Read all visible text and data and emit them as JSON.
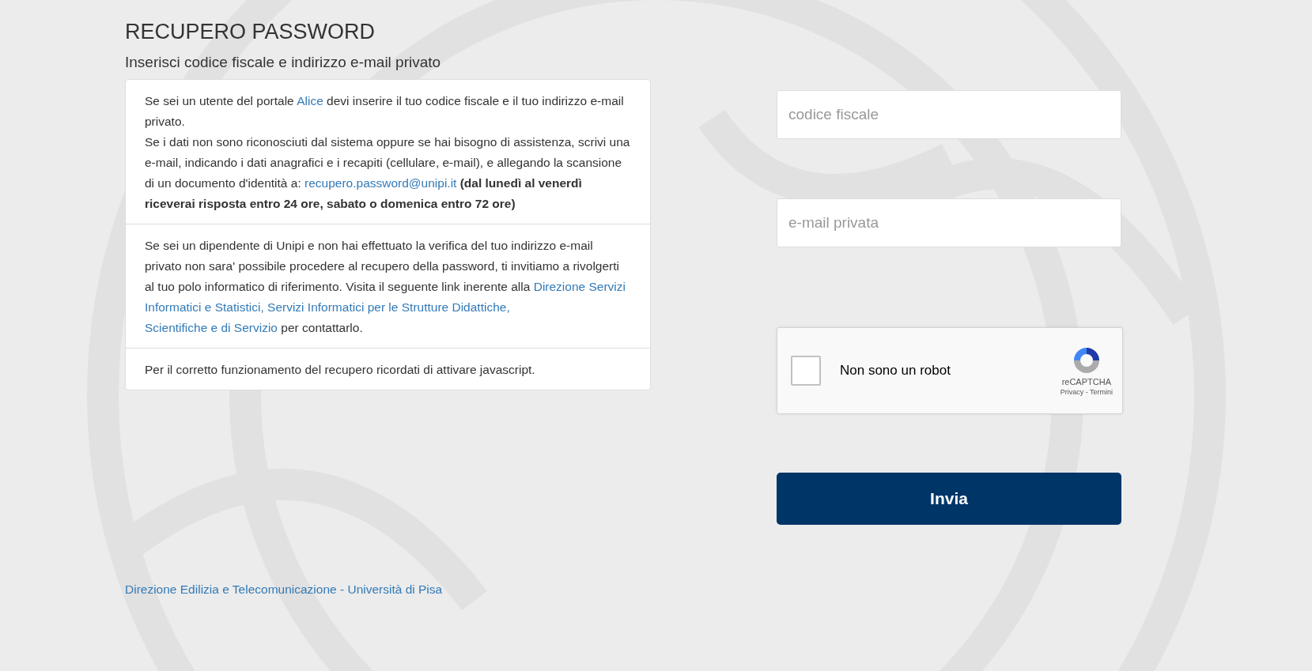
{
  "page": {
    "title": "RECUPERO PASSWORD",
    "subtitle": "Inserisci codice fiscale e indirizzo e-mail privato"
  },
  "info_panel": {
    "sections": [
      {
        "paragraphs": [
          [
            {
              "kind": "text",
              "text": "Se sei un utente del portale"
            },
            {
              "kind": "link",
              "text": "Alice"
            },
            {
              "kind": "text",
              "text": "devi inserire il tuo codice fiscale e il tuo indirizzo e-mail privato."
            }
          ],
          [
            {
              "kind": "text",
              "text": "Se i dati non sono riconosciuti dal sistema oppure se hai bisogno di assistenza, scrivi una e-mail, indicando i dati anagrafici e i recapiti (cellulare, e-mail), e allegando la scansione di un documento d'identità a:"
            },
            {
              "kind": "link",
              "text": "recupero.password@unipi.it"
            },
            {
              "kind": "text",
              "text": "**(dal lunedì al venerdì riceverai risposta entro 24 ore, sabato o domenica entro 72 ore)**"
            }
          ]
        ]
      },
      {
        "paragraphs": [
          [
            {
              "kind": "text",
              "text": "Se sei un dipendente di Unipi e non hai effettuato la verifica del tuo indirizzo e-mail privato non sara' possibile procedere al recupero della password, ti invitiamo a rivolgerti al tuo polo informatico di riferimento. Visita il seguente link inerente alla"
            },
            {
              "kind": "link",
              "text": "Direzione Servizi"
            },
            {
              "kind": "link",
              "text": "Informatici e Statistici, Servizi Informatici per le Strutture Didattiche,"
            },
            {
              "kind": "link",
              "text": "Scientifiche e di Servizio"
            },
            {
              "kind": "text",
              "text": "per contattarlo."
            }
          ]
        ]
      },
      {
        "paragraphs": [
          [
            {
              "kind": "text",
              "text": "Per il corretto funzionamento del recupero ricordati di attivare javascript."
            }
          ]
        ]
      }
    ]
  },
  "form": {
    "fields": [
      {
        "placeholder": "codice fiscale"
      },
      {
        "placeholder": "e-mail privata"
      }
    ],
    "captcha": {
      "label": "Non sono un robot",
      "checked": false,
      "brand": "reCAPTCHA",
      "links": "Privacy - Termini"
    },
    "submit": "Invia"
  },
  "footer": {
    "link": "Direzione Edilizia e Telecomunicazione - Università di Pisa"
  }
}
